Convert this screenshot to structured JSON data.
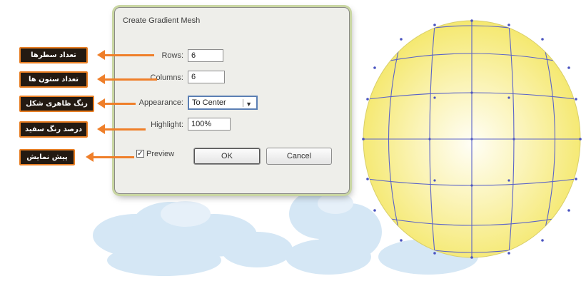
{
  "dialog": {
    "title": "Create Gradient Mesh",
    "rows_label": "Rows:",
    "rows_value": "6",
    "columns_label": "Columns:",
    "columns_value": "6",
    "appearance_label": "Appearance:",
    "appearance_value": "To Center",
    "highlight_label": "Highlight:",
    "highlight_value": "100%",
    "preview_label": "Preview",
    "preview_checked": true,
    "ok_label": "OK",
    "cancel_label": "Cancel"
  },
  "callouts": [
    "تعداد سطرها",
    "تعداد ستون ها",
    "رنگ ظاهری شکل",
    "درصد رنگ سفید",
    "پیش نمایش"
  ],
  "colors": {
    "callout_bg": "#231a12",
    "callout_border": "#e87e23",
    "arrow": "#ef7f2a",
    "sphere_fill": "#f6eb7a",
    "mesh_line": "#5a63c8",
    "clouds": "#d5e7f5"
  },
  "icons": {
    "checkbox": "checkmark",
    "dropdown": "triangle-down"
  }
}
